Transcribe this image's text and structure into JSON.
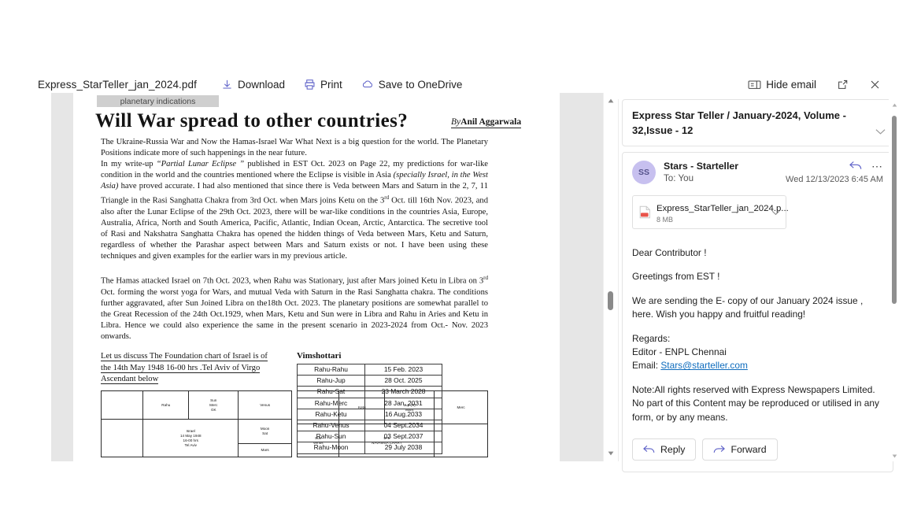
{
  "toolbar": {
    "filename": "Express_StarTeller_jan_2024.pdf",
    "download_label": "Download",
    "print_label": "Print",
    "save_onedrive_label": "Save to OneDrive",
    "hide_email_label": "Hide email",
    "popout_label": "",
    "close_label": ""
  },
  "pdf": {
    "kicker": "planetary indications",
    "headline": "Will War spread to other countries?",
    "byline_prefix": "By",
    "byline_author": "Anil Aggarwala",
    "paragraph1": "The Ukraine-Russia War and Now the Hamas-Israel War What Next is a big question for the world. The Planetary Positions indicate more of such happenings in the near future.",
    "paragraph2_a": "In my write-up ",
    "paragraph2_italic1": "“Partial Lunar Eclipse ”",
    "paragraph2_b": " published in EST Oct. 2023 on Page 22, my predictions for war-like condition in the world and the countries mentioned where the Eclipse is visible in Asia ",
    "paragraph2_italic2": "(specially Israel, in the West Asia)",
    "paragraph2_c": " have proved accurate.  I had also mentioned that since there is Veda between Mars and Saturn in the 2, 7, 11 Triangle in the Rasi Sanghatta Chakra from 3rd Oct. when Mars joins Ketu on the 3",
    "paragraph2_sup": "rd",
    "paragraph2_d": " Oct. till 16th Nov. 2023, and also after the Lunar Eclipse of the 29th Oct. 2023, there will be war-like conditions in the countries Asia, Europe, Australia,  Africa, North and South America, Pacific, Atlantic, Indian Ocean, Arctic, Antarctica. The secretive tool of Rasi and Nakshatra Sanghatta Chakra has opened the hidden things of Veda between Mars, Ketu and Saturn, regardless of whether the Parashar aspect between Mars and Saturn exists or not. I have been using these techniques and given examples for the earlier wars in my previous article.",
    "paragraph3_a": "The Hamas attacked Israel on 7th Oct. 2023, when Rahu was Stationary, just after Mars joined Ketu in Libra on 3",
    "paragraph3_sup": "rd",
    "paragraph3_b": " Oct. forming the worst yoga for Wars, and mutual Veda with Saturn in the Rasi Sanghatta chakra. The conditions further aggravated, after Sun Joined Libra on the18th Oct. 2023. The planetary positions are somewhat parallel to the Great Recession of the 24th Oct.1929, when Mars, Ketu and Sun were in Libra and Rahu in Aries and Ketu in Libra.  Hence we could also experience the same in the present scenario in 2023-2024 from Oct.- Nov. 2023 onwards.",
    "foundation_line1": "Let us discuss The Foundation chart of Israel is of",
    "foundation_line2": "the 14th May 1948 16-00 hrs .Tel Aviv of Virgo",
    "foundation_line3": "Ascendant below",
    "vimshottari_title": "Vimshottari",
    "vimshottari_rows": [
      {
        "period": "Rahu-Rahu",
        "date": "15 Feb. 2023"
      },
      {
        "period": "Rahu-Jup",
        "date": "28 Oct. 2025"
      },
      {
        "period": "Rahu-Sat",
        "date": "23 March 2028"
      },
      {
        "period": "Rahu-Merc",
        "date": "28 Jan. 2031"
      },
      {
        "period": "Rahu-Ketu",
        "date": "16 Aug.2033"
      },
      {
        "period": "Rahu-Venus",
        "date": "04 Sept.2034"
      },
      {
        "period": "Rahu-Sun",
        "date": "03 Sept.2037"
      },
      {
        "period": "Rahu-Moon",
        "date": "29 July 2038"
      }
    ],
    "rasi_chart": {
      "cells": {
        "r1c1": "",
        "r1c2": "Rahu",
        "r1c3": "Sun\nMerc\nGK",
        "r1c4": "Venus",
        "r2c1": "",
        "r2center": "Israel\n14 May 1948\n16-00 hrs\nTel Aviv",
        "r2c4": "Moon\nSat",
        "r3c4": "Mars"
      }
    },
    "navamsa_chart": {
      "cells": {
        "r1c1": "",
        "r1c2": "Ketu",
        "r1c3": "Jup (R)\nMars",
        "r1c4": "Merc",
        "r2c1": "Sun\nVenus",
        "r2center": "D-9\nNAVAMSA CHART",
        "r2c4": ""
      }
    }
  },
  "email": {
    "subject": "Express Star Teller / January-2024, Volume - 32,Issue - 12",
    "avatar_initials": "SS",
    "sender_name": "Stars - Starteller",
    "recipient": "To: You",
    "date": "Wed 12/13/2023 6:45 AM",
    "attachment": {
      "name": "Express_StarTeller_jan_2024.p...",
      "size": "8 MB"
    },
    "body": {
      "greeting": "Dear Contributor !",
      "line2": "Greetings from EST !",
      "line3": "We are sending the E- copy of  our January 2024 issue , here. Wish you happy and fruitful reading!",
      "regards": "Regards:",
      "editor": "Editor - ENPL Chennai",
      "email_label": "Email: ",
      "email_address": "Stars@starteller.com",
      "note": "Note:All rights reserved with Express Newspapers Limited. No part of this Content may be reproduced or utilised in any form, or by any means."
    },
    "reply_label": "Reply",
    "forward_label": "Forward"
  },
  "colors": {
    "accent": "#5b5fc7",
    "link": "#0f6cbd",
    "avatar_bg": "#c7c0ef",
    "viewer_bg": "#e6e6e6"
  }
}
